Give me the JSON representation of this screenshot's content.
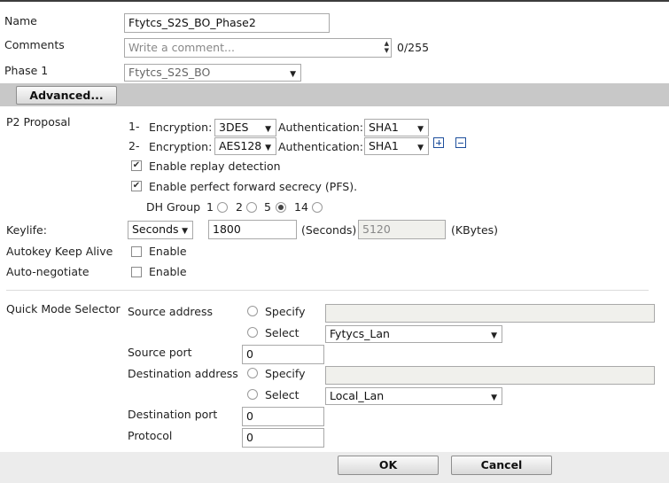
{
  "form": {
    "name_label": "Name",
    "name_value": "Ftytcs_S2S_BO_Phase2",
    "comments_label": "Comments",
    "comments_placeholder": "Write a comment...",
    "comments_count": "0/255",
    "phase1_label": "Phase 1",
    "phase1_value": "Ftytcs_S2S_BO",
    "advanced_button": "Advanced..."
  },
  "p2": {
    "label": "P2 Proposal",
    "proposals": [
      {
        "index": "1-",
        "enc_label": "Encryption:",
        "enc_value": "3DES",
        "auth_label": "Authentication:",
        "auth_value": "SHA1"
      },
      {
        "index": "2-",
        "enc_label": "Encryption:",
        "enc_value": "AES128",
        "auth_label": "Authentication:",
        "auth_value": "SHA1"
      }
    ],
    "replay_label": "Enable replay detection",
    "replay_checked": true,
    "pfs_label": "Enable perfect forward secrecy (PFS).",
    "pfs_checked": true,
    "dh_label": "DH Group",
    "dh_options": [
      "1",
      "2",
      "5",
      "14"
    ],
    "dh_selected": "5"
  },
  "keylife": {
    "label": "Keylife:",
    "type_value": "Seconds",
    "seconds_value": "1800",
    "seconds_unit": "(Seconds)",
    "kbytes_value": "5120",
    "kbytes_unit": "(KBytes)"
  },
  "autokey": {
    "label": "Autokey Keep Alive",
    "option": "Enable",
    "checked": false
  },
  "autoneg": {
    "label": "Auto-negotiate",
    "option": "Enable",
    "checked": false
  },
  "qms": {
    "label": "Quick Mode Selector",
    "source_address_label": "Source address",
    "specify_label": "Specify",
    "select_label": "Select",
    "source_select_value": "Fytycs_Lan",
    "source_port_label": "Source port",
    "source_port_value": "0",
    "destination_address_label": "Destination address",
    "destination_select_value": "Local_Lan",
    "destination_port_label": "Destination port",
    "destination_port_value": "0",
    "protocol_label": "Protocol",
    "protocol_value": "0"
  },
  "footer": {
    "ok": "OK",
    "cancel": "Cancel"
  }
}
